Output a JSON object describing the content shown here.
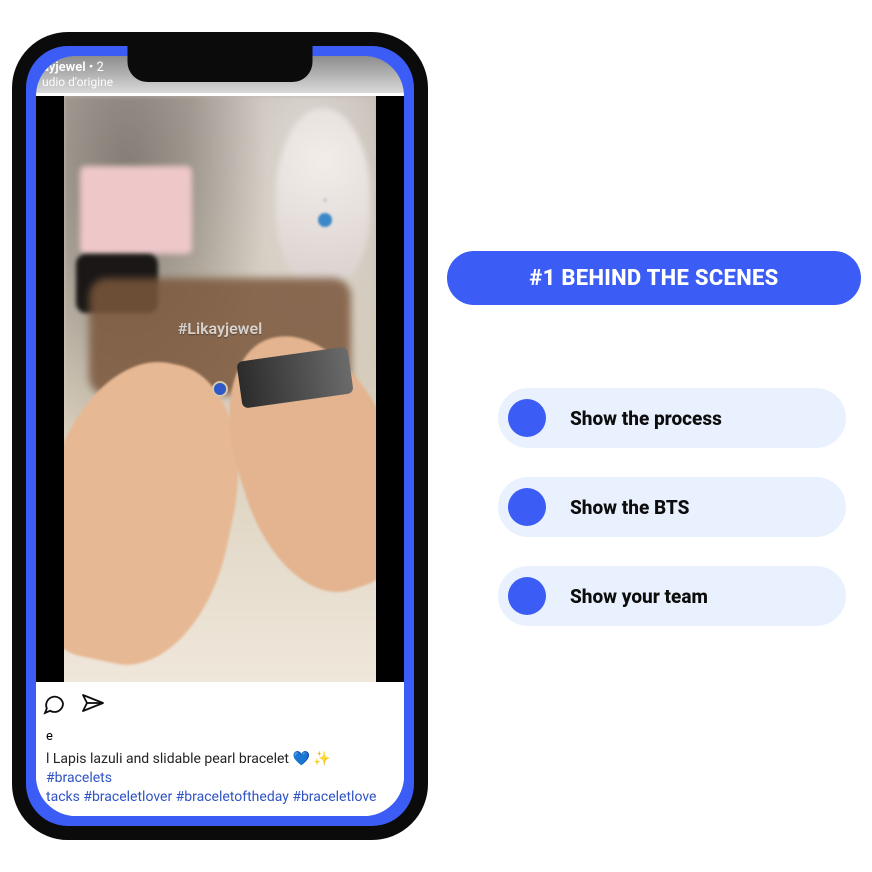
{
  "phone": {
    "post": {
      "username": "ayjewel",
      "timestamp": "2",
      "subline": "udio d'origine",
      "watermark": "#Likayjewel",
      "likes_line": "e",
      "caption_prefix": "l Lapis lazuli and slidable pearl bracelet ",
      "emoji": "💙 ✨",
      "hashtags_line1": "#bracelets",
      "hashtags_line2": "tacks #braceletlover #braceletoftheday #braceletlove"
    },
    "icons": {
      "comment": "comment-icon",
      "share": "share-icon"
    }
  },
  "headline": "#1 BEHIND THE SCENES",
  "bullets": [
    "Show the process",
    "Show the BTS",
    "Show your team"
  ]
}
